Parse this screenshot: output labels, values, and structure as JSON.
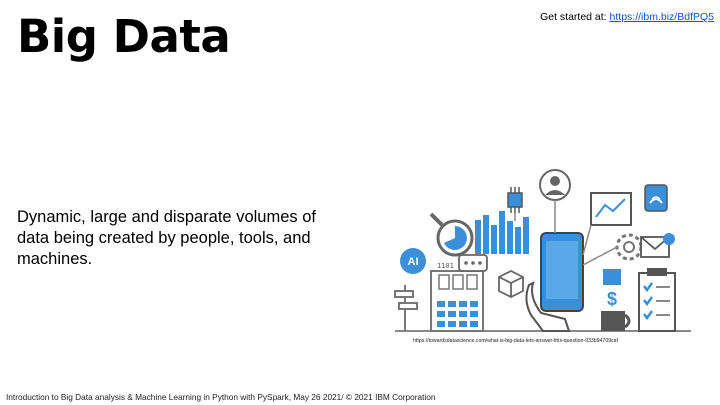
{
  "slide": {
    "title": "Big Data",
    "get_started_label": "Get started at:",
    "get_started_link": "https://ibm.biz/BdfPQ5",
    "body_text": "Dynamic, large and disparate volumes of data being created by people, tools, and machines.",
    "image_source": "https://towardsdatascience.com/what-is-big-data-lets-answer-this-question-933b94709caf",
    "footer": "Introduction to Big Data analysis & Machine Learning in Python with PySpark, May 26 2021/ © 2021 IBM Corporation"
  },
  "illustration": {
    "ai_badge": "AI",
    "binary_text": "1101",
    "accent_color": "#3b8fd9",
    "gray_color": "#8a8a8a"
  }
}
